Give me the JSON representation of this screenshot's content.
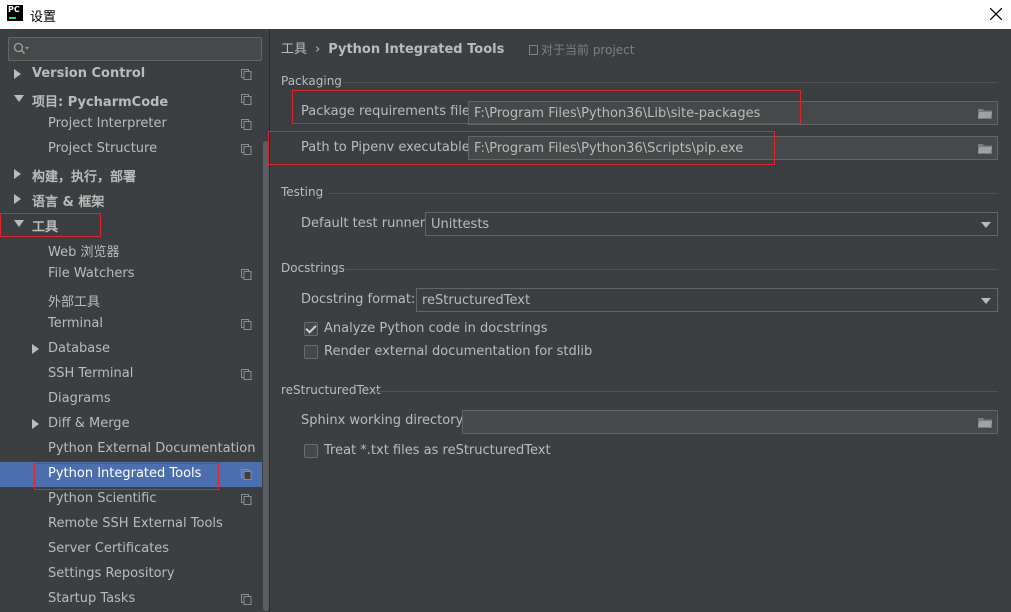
{
  "window": {
    "title": "设置",
    "app_icon_text": "PC"
  },
  "sidebar": {
    "search_placeholder": "",
    "items": [
      {
        "label": "Version Control",
        "level": 0,
        "arrow": "right",
        "has_icon": true
      },
      {
        "label": "项目: PycharmCode",
        "level": 0,
        "arrow": "down",
        "has_icon": true
      },
      {
        "label": "Project Interpreter",
        "level": 1,
        "arrow": "",
        "has_icon": true
      },
      {
        "label": "Project Structure",
        "level": 1,
        "arrow": "",
        "has_icon": true
      },
      {
        "label": "构建，执行，部署",
        "level": 0,
        "arrow": "right",
        "has_icon": false
      },
      {
        "label": "语言 & 框架",
        "level": 0,
        "arrow": "right",
        "has_icon": false
      },
      {
        "label": "工具",
        "level": 0,
        "arrow": "down",
        "has_icon": false
      },
      {
        "label": "Web 浏览器",
        "level": 1,
        "arrow": "",
        "has_icon": false
      },
      {
        "label": "File Watchers",
        "level": 1,
        "arrow": "",
        "has_icon": true
      },
      {
        "label": "外部工具",
        "level": 1,
        "arrow": "",
        "has_icon": false
      },
      {
        "label": "Terminal",
        "level": 1,
        "arrow": "",
        "has_icon": true
      },
      {
        "label": "Database",
        "level": 1,
        "arrow": "right",
        "has_icon": false
      },
      {
        "label": "SSH Terminal",
        "level": 1,
        "arrow": "",
        "has_icon": true
      },
      {
        "label": "Diagrams",
        "level": 1,
        "arrow": "",
        "has_icon": false
      },
      {
        "label": "Diff & Merge",
        "level": 1,
        "arrow": "right",
        "has_icon": false
      },
      {
        "label": "Python External Documentation",
        "level": 1,
        "arrow": "",
        "has_icon": false
      },
      {
        "label": "Python Integrated Tools",
        "level": 1,
        "arrow": "",
        "has_icon": true,
        "selected": true
      },
      {
        "label": "Python Scientific",
        "level": 1,
        "arrow": "",
        "has_icon": true
      },
      {
        "label": "Remote SSH External Tools",
        "level": 1,
        "arrow": "",
        "has_icon": false
      },
      {
        "label": "Server Certificates",
        "level": 1,
        "arrow": "",
        "has_icon": false
      },
      {
        "label": "Settings Repository",
        "level": 1,
        "arrow": "",
        "has_icon": false
      },
      {
        "label": "Startup Tasks",
        "level": 1,
        "arrow": "",
        "has_icon": true
      }
    ]
  },
  "breadcrumb": {
    "parent": "工具",
    "separator": "›",
    "current": "Python Integrated Tools"
  },
  "scope_note": "对于当前 project",
  "packaging": {
    "section": "Packaging",
    "req_label": "Package requirements file:",
    "req_value": "F:\\Program Files\\Python36\\Lib\\site-packages",
    "pipenv_label": "Path to Pipenv executable:",
    "pipenv_value": "F:\\Program Files\\Python36\\Scripts\\pip.exe"
  },
  "testing": {
    "section": "Testing",
    "runner_label": "Default test runner:",
    "runner_value": "Unittests"
  },
  "docstrings": {
    "section": "Docstrings",
    "format_label": "Docstring format:",
    "format_value": "reStructuredText",
    "analyze_label": "Analyze Python code in docstrings",
    "analyze_checked": true,
    "render_label": "Render external documentation for stdlib",
    "render_checked": false
  },
  "rest": {
    "section": "reStructuredText",
    "sphinx_label": "Sphinx working directory:",
    "sphinx_value": "",
    "treat_label": "Treat *.txt files as reStructuredText",
    "treat_checked": false
  },
  "colors": {
    "background": "#3c3f41",
    "selection": "#4b6eaf",
    "text": "#bbbbbb",
    "highlight_box": "#e0242b"
  }
}
